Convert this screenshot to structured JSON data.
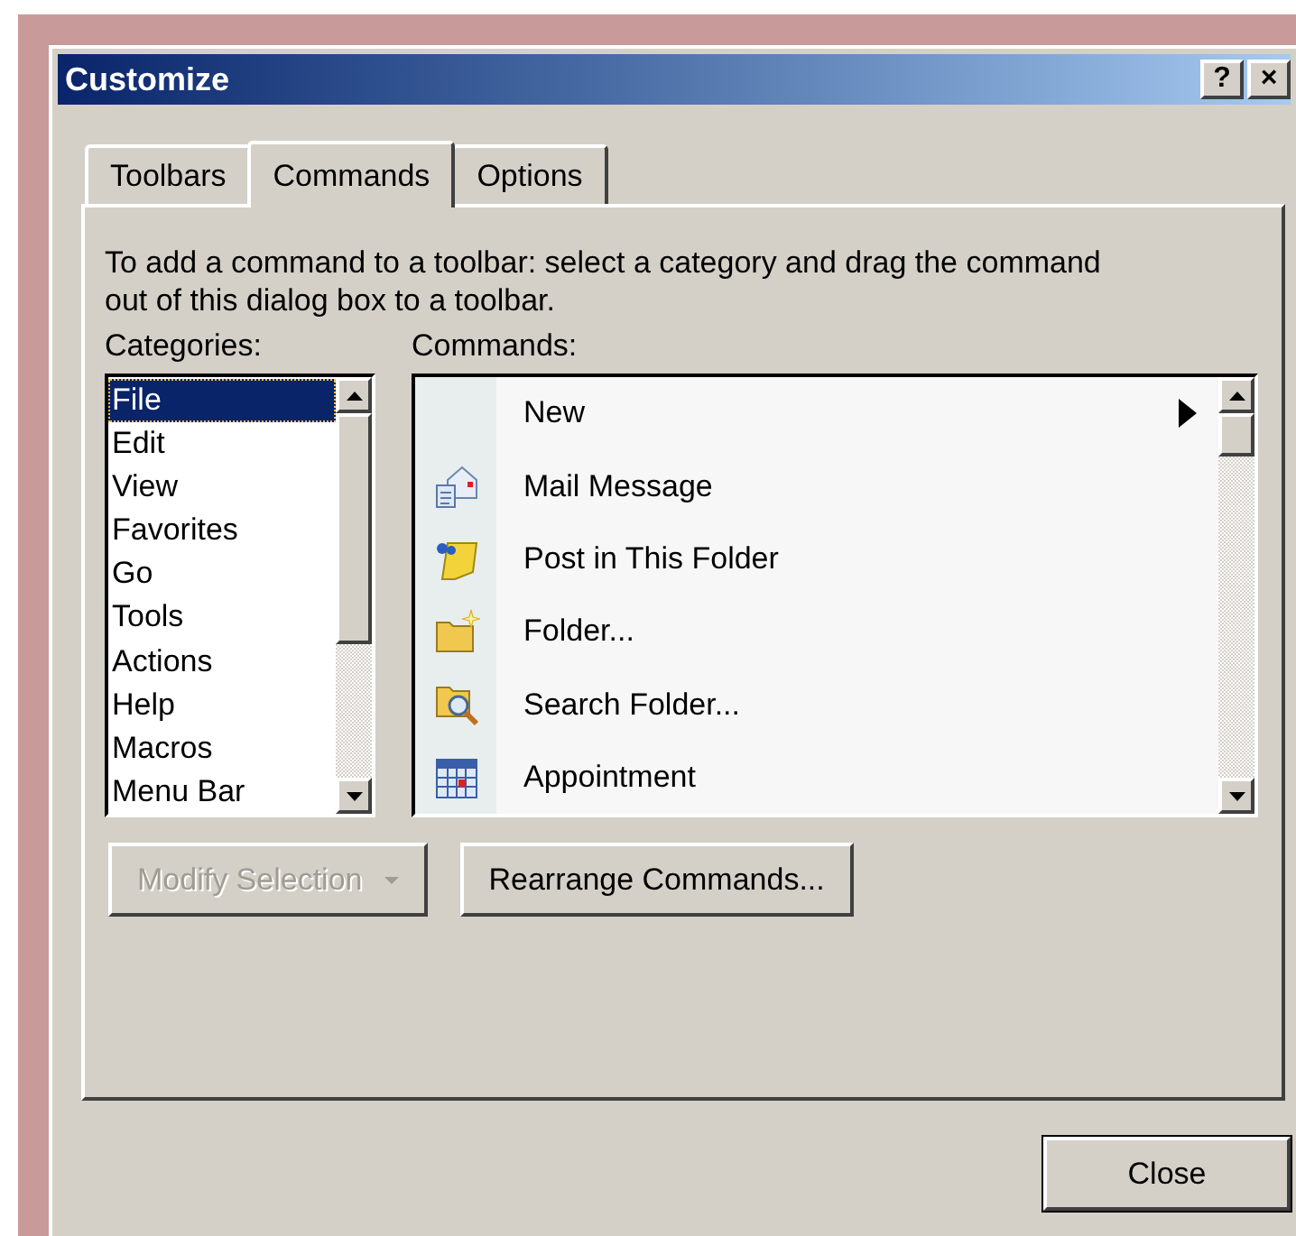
{
  "window": {
    "title": "Customize",
    "title_buttons": [
      "?",
      "×"
    ]
  },
  "tabs": [
    {
      "label": "Toolbars",
      "selected": false
    },
    {
      "label": "Commands",
      "selected": true
    },
    {
      "label": "Options",
      "selected": false
    }
  ],
  "instructions": "To add a command to a toolbar: select a category and drag the command out of this dialog box to a toolbar.",
  "categories": {
    "label": "Categories:",
    "items": [
      {
        "label": "File",
        "selected": true
      },
      {
        "label": "Edit",
        "selected": false
      },
      {
        "label": "View",
        "selected": false
      },
      {
        "label": "Favorites",
        "selected": false
      },
      {
        "label": "Go",
        "selected": false
      },
      {
        "label": "Tools",
        "selected": false
      },
      {
        "label": "Actions",
        "selected": false
      },
      {
        "label": "Help",
        "selected": false
      },
      {
        "label": "Macros",
        "selected": false
      },
      {
        "label": "Menu Bar",
        "selected": false
      }
    ]
  },
  "commands": {
    "label": "Commands:",
    "items": [
      {
        "label": "New",
        "kind": "submenu"
      },
      {
        "label": "Mail Message",
        "kind": "command"
      },
      {
        "label": "Post in This Folder",
        "kind": "command"
      },
      {
        "label": "Folder...",
        "kind": "command"
      },
      {
        "label": "Search Folder...",
        "kind": "command"
      },
      {
        "label": "Appointment",
        "kind": "command"
      }
    ]
  },
  "buttons": [
    {
      "label": "Modify Selection",
      "disabled": true,
      "kind": "dropdown"
    },
    {
      "label": "Rearrange Commands...",
      "disabled": false,
      "kind": "plain"
    }
  ],
  "close_button": "Close"
}
